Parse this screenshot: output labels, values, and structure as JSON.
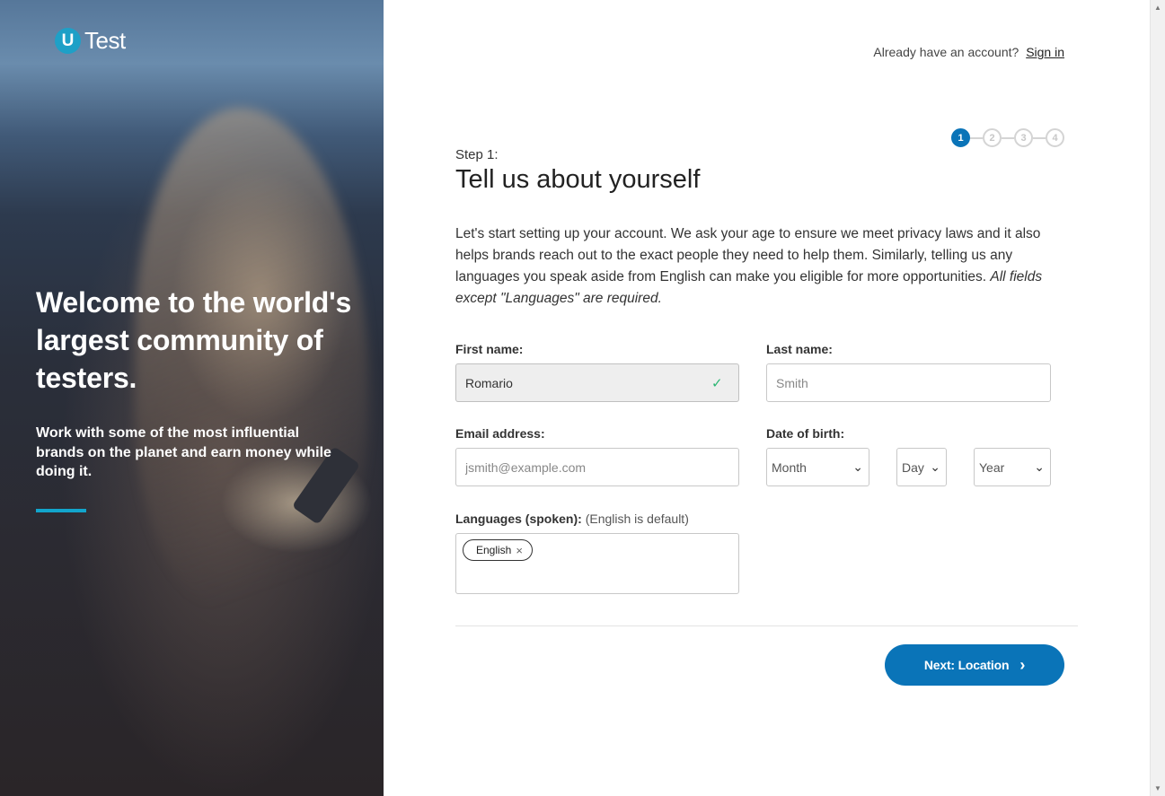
{
  "hero": {
    "logo_letter": "U",
    "logo_text": "Test",
    "title": "Welcome to the world's largest community of testers.",
    "subtitle": "Work with some of the most influential brands on the planet and earn money while doing it."
  },
  "header": {
    "account_prompt": "Already have an account?",
    "sign_in_label": "Sign in"
  },
  "steps": {
    "items": [
      "1",
      "2",
      "3",
      "4"
    ],
    "active_index": 0
  },
  "form": {
    "step_label": "Step 1:",
    "title": "Tell us about yourself",
    "intro": "Let's start setting up your account. We ask your age to ensure we meet privacy laws and it also helps brands reach out to the exact people they need to help them. Similarly, telling us any languages you speak aside from English can make you eligible for more opportunities.",
    "intro_note": "All fields except \"Languages\" are required.",
    "first_name": {
      "label": "First name:",
      "value": "Romario",
      "placeholder": ""
    },
    "last_name": {
      "label": "Last name:",
      "value": "",
      "placeholder": "Smith"
    },
    "email": {
      "label": "Email address:",
      "value": "",
      "placeholder": "jsmith@example.com"
    },
    "dob": {
      "label": "Date of birth:",
      "month": "Month",
      "day": "Day",
      "year": "Year"
    },
    "languages": {
      "label": "Languages (spoken):",
      "note": "(English is default)",
      "tags": [
        "English"
      ]
    },
    "next_label": "Next: Location"
  },
  "colors": {
    "primary": "#0a74b8",
    "accent": "#12a5cc",
    "success": "#2bb673"
  }
}
